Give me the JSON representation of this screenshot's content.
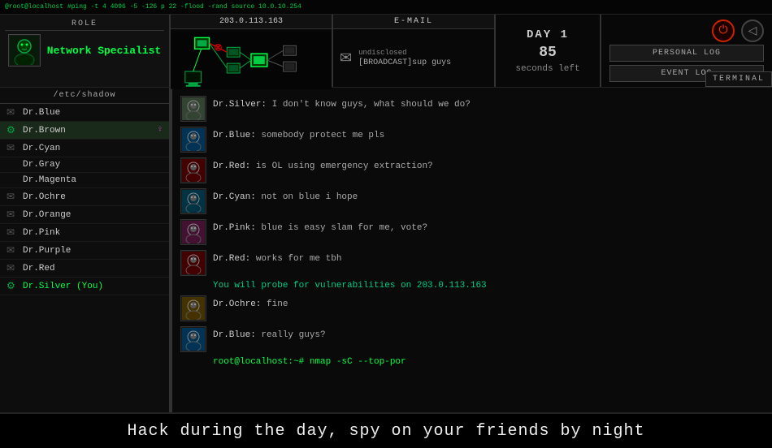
{
  "topBar": {
    "cmdText": "@root@localhost #ping -t 4 4096 -5 -126 p 22    -flood  -rand source 10.0.10.254",
    "role": {
      "label": "ROLE",
      "name": "Network Specialist"
    },
    "network": {
      "title": "203.0.113.163"
    },
    "email": {
      "title": "E-MAIL",
      "sender": "undisclosed",
      "subject": "[BROADCAST]sup guys"
    },
    "timer": {
      "day": "DAY 1",
      "value": "85",
      "unit": "seconds left"
    },
    "controls": {
      "personalLog": "PERSONAL LOG",
      "eventLog": "EVENT LOG",
      "terminal": "TERMINAL"
    }
  },
  "sidebar": {
    "header": "/etc/shadow",
    "players": [
      {
        "name": "Dr.Blue",
        "icon": "✉",
        "iconColor": "gray",
        "active": false
      },
      {
        "name": "Dr.Brown",
        "icon": "⚙",
        "iconColor": "green",
        "active": true,
        "badge": "♀"
      },
      {
        "name": "Dr.Cyan",
        "icon": "✉",
        "iconColor": "gray",
        "active": false
      },
      {
        "name": "Dr.Gray",
        "icon": "",
        "iconColor": "gray",
        "active": false
      },
      {
        "name": "Dr.Magenta",
        "icon": "",
        "iconColor": "gray",
        "active": false
      },
      {
        "name": "Dr.Ochre",
        "icon": "✉",
        "iconColor": "gray",
        "active": false
      },
      {
        "name": "Dr.Orange",
        "icon": "✉",
        "iconColor": "gray",
        "active": false
      },
      {
        "name": "Dr.Pink",
        "icon": "✉",
        "iconColor": "gray",
        "active": false
      },
      {
        "name": "Dr.Purple",
        "icon": "✉",
        "iconColor": "gray",
        "active": false
      },
      {
        "name": "Dr.Red",
        "icon": "✉",
        "iconColor": "gray",
        "active": false
      },
      {
        "name": "Dr.Silver (You)",
        "icon": "⚙",
        "iconColor": "green",
        "active": false,
        "isYou": true
      }
    ]
  },
  "chat": {
    "messages": [
      {
        "speaker": "Dr.Silver",
        "text": "I don't know guys, what should we do?"
      },
      {
        "speaker": "Dr.Blue",
        "text": "somebody protect me pls"
      },
      {
        "speaker": "Dr.Red",
        "text": "is OL using emergency extraction?"
      },
      {
        "speaker": "Dr.Cyan",
        "text": "not on blue i hope"
      },
      {
        "speaker": "Dr.Pink",
        "text": "blue is easy slam for me, vote?"
      },
      {
        "speaker": "Dr.Red",
        "text": "works for me tbh"
      }
    ],
    "systemMessage": "You will probe for vulnerabilities on  203.0.113.163",
    "postMessages": [
      {
        "speaker": "Dr.Ochre",
        "text": "fine"
      },
      {
        "speaker": "Dr.Blue",
        "text": "really guys?"
      }
    ],
    "prompt": "root@localhost:~# nmap -sC --top-por"
  },
  "bottomBar": {
    "tagline": "Hack during the day, spy on your friends by night"
  }
}
